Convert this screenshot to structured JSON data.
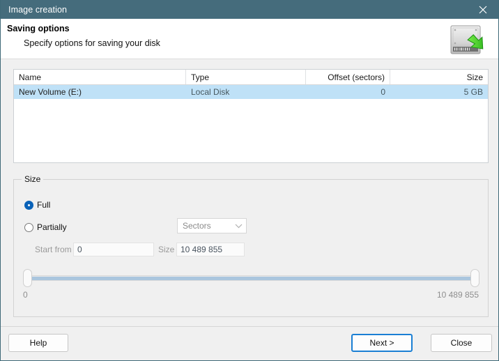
{
  "window": {
    "title": "Image creation",
    "close_icon": "close-x-icon"
  },
  "header": {
    "title": "Saving options",
    "subtitle": "Specify options for saving your disk",
    "icon": "hard-disk-save-icon"
  },
  "disk_table": {
    "columns": [
      "Name",
      "Type",
      "Offset (sectors)",
      "Size"
    ],
    "rows": [
      {
        "name": "New Volume (E:)",
        "type": "Local Disk",
        "offset": "0",
        "size": "5 GB"
      }
    ]
  },
  "size_group": {
    "legend": "Size",
    "options": [
      {
        "label": "Full",
        "selected": true
      },
      {
        "label": "Partially",
        "selected": false
      }
    ],
    "unit_select": {
      "value": "Sectors",
      "arrow_icon": "chevron-down-icon"
    },
    "start_from": {
      "label": "Start from",
      "value": "0"
    },
    "size_field": {
      "label": "Size",
      "value": "10 489 855"
    },
    "range_slider": {
      "min_label": "0",
      "max_label": "10 489 855"
    }
  },
  "footer": {
    "help_label": "Help",
    "next_label": "Next >",
    "close_label": "Close"
  },
  "colors": {
    "titlebar": "#456c7c",
    "accent": "#0a62b8",
    "selection": "#bfe1f7",
    "default_button_border": "#1a7fd4",
    "slider_fill": "#aac6de"
  }
}
